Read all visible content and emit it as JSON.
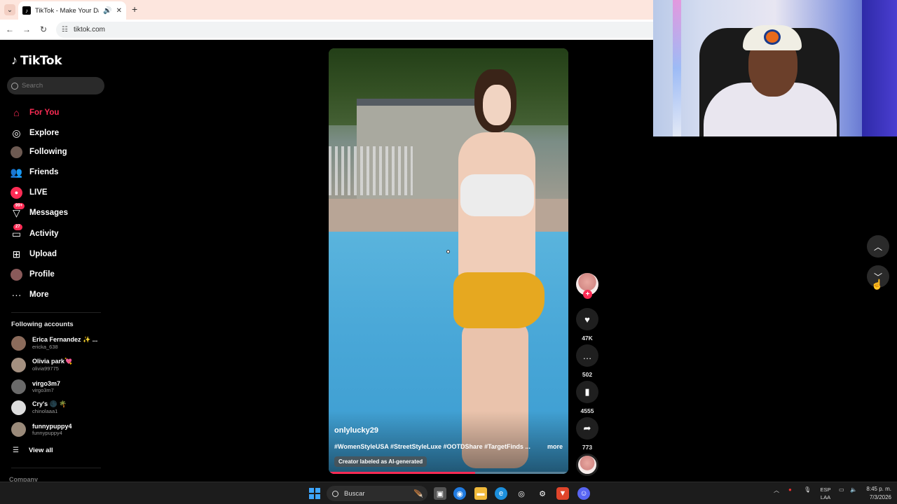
{
  "browser": {
    "tab_title": "TikTok - Make Your Day",
    "url": "tiktok.com",
    "new_tab": "+",
    "close": "✕"
  },
  "app": {
    "logo_text": "TikTok",
    "search_placeholder": "Search"
  },
  "nav": [
    {
      "label": "For You",
      "icon": "home-icon",
      "active": true
    },
    {
      "label": "Explore",
      "icon": "compass-icon"
    },
    {
      "label": "Following",
      "icon": "following-avatar-icon"
    },
    {
      "label": "Friends",
      "icon": "friends-icon"
    },
    {
      "label": "LIVE",
      "icon": "live-icon"
    },
    {
      "label": "Messages",
      "icon": "messages-icon",
      "badge": "99+"
    },
    {
      "label": "Activity",
      "icon": "activity-icon",
      "badge": "27"
    },
    {
      "label": "Upload",
      "icon": "upload-icon"
    },
    {
      "label": "Profile",
      "icon": "profile-icon"
    },
    {
      "label": "More",
      "icon": "more-icon"
    }
  ],
  "following": {
    "title": "Following accounts",
    "accounts": [
      {
        "name": "Erica Fernandez ✨ ...",
        "handle": "ericka_638"
      },
      {
        "name": "Olivia park💘",
        "handle": "olivia99775"
      },
      {
        "name": "virgo3m7",
        "handle": "virgo3m7"
      },
      {
        "name": "Cry's 🌑 🌴",
        "handle": "chinolaaa1"
      },
      {
        "name": "funnypuppy4",
        "handle": "funnypuppy4"
      }
    ],
    "view_all": "View all"
  },
  "company_label": "Company",
  "video": {
    "author": "onlylucky29",
    "caption": "#WomenStyleUSA #StreetStyleLuxe #OOTDShare #TargetFinds ...",
    "more": "more",
    "ai_label": "Creator labeled as AI-generated",
    "progress": 0.61
  },
  "actions": {
    "likes": "47K",
    "comments": "502",
    "saves": "4555",
    "shares": "773"
  },
  "taskbar": {
    "search_text": "Buscar",
    "lang_1": "ESP",
    "lang_2": "LAA",
    "time": "8:45 p. m.",
    "date": "7/3/2026"
  },
  "colors": {
    "accent": "#fe2c55",
    "background": "#000000"
  }
}
